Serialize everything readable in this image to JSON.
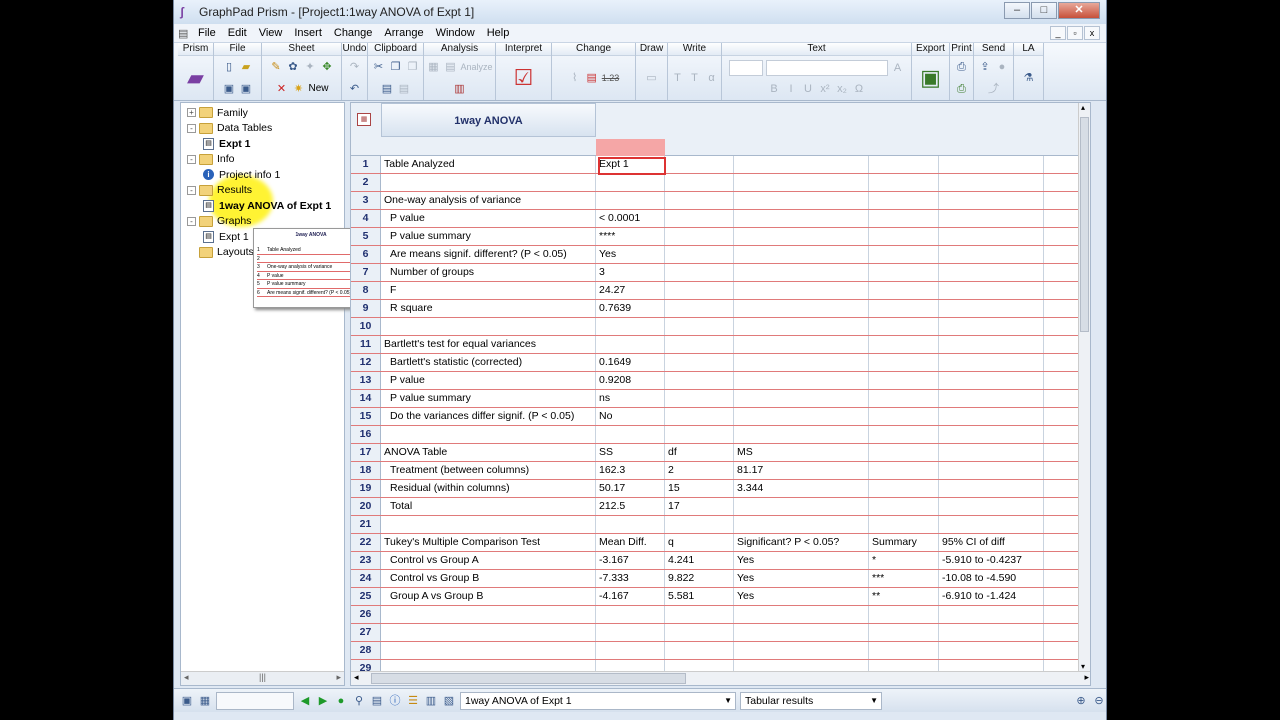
{
  "window": {
    "title": "GraphPad Prism - [Project1:1way ANOVA of Expt 1]"
  },
  "menu": [
    "File",
    "Edit",
    "View",
    "Insert",
    "Change",
    "Arrange",
    "Window",
    "Help"
  ],
  "ribbon": {
    "groups": [
      "Prism",
      "File",
      "Sheet",
      "Undo",
      "Clipboard",
      "Analysis",
      "Interpret",
      "Change",
      "Draw",
      "Write",
      "Text",
      "Export",
      "Print",
      "Send",
      "LA"
    ],
    "new_label": "New",
    "analyze_label": "Analyze",
    "change_value": "1.23"
  },
  "navigator": {
    "items": [
      {
        "label": "Family",
        "kind": "folder",
        "level": 0,
        "exp": "+"
      },
      {
        "label": "Data Tables",
        "kind": "folder",
        "level": 0,
        "exp": "-"
      },
      {
        "label": "Expt 1",
        "kind": "sheet",
        "level": 1,
        "bold": true
      },
      {
        "label": "Info",
        "kind": "folder",
        "level": 0,
        "exp": "-"
      },
      {
        "label": "Project info 1",
        "kind": "info",
        "level": 1
      },
      {
        "label": "Results",
        "kind": "folder",
        "level": 0,
        "exp": "-"
      },
      {
        "label": "1way ANOVA of Expt 1",
        "kind": "sheet",
        "level": 1,
        "bold": true
      },
      {
        "label": "Graphs",
        "kind": "folder",
        "level": 0,
        "exp": "-"
      },
      {
        "label": "Expt 1",
        "kind": "sheet",
        "level": 1
      },
      {
        "label": "Layouts",
        "kind": "folder",
        "level": 0,
        "exp": ""
      }
    ],
    "thumb": {
      "title": "1way ANOVA",
      "rows": [
        "Table Analyzed",
        "",
        "One-way analysis of variance",
        "P value",
        "P value summary",
        "Are means signif. different? (P < 0.05)"
      ]
    }
  },
  "sheet": {
    "name": "1way ANOVA",
    "rows": [
      [
        "1",
        "Table Analyzed",
        "Expt 1",
        "",
        "",
        "",
        ""
      ],
      [
        "2",
        "",
        "",
        "",
        "",
        "",
        ""
      ],
      [
        "3",
        "One-way analysis of variance",
        "",
        "",
        "",
        "",
        ""
      ],
      [
        "4",
        "  P value",
        "< 0.0001",
        "",
        "",
        "",
        ""
      ],
      [
        "5",
        "  P value summary",
        "****",
        "",
        "",
        "",
        ""
      ],
      [
        "6",
        "  Are means signif. different? (P < 0.05)",
        "Yes",
        "",
        "",
        "",
        ""
      ],
      [
        "7",
        "  Number of groups",
        "3",
        "",
        "",
        "",
        ""
      ],
      [
        "8",
        "  F",
        "24.27",
        "",
        "",
        "",
        ""
      ],
      [
        "9",
        "  R square",
        "0.7639",
        "",
        "",
        "",
        ""
      ],
      [
        "10",
        "",
        "",
        "",
        "",
        "",
        ""
      ],
      [
        "11",
        "Bartlett's test for equal variances",
        "",
        "",
        "",
        "",
        ""
      ],
      [
        "12",
        "  Bartlett's statistic (corrected)",
        "0.1649",
        "",
        "",
        "",
        ""
      ],
      [
        "13",
        "  P value",
        "0.9208",
        "",
        "",
        "",
        ""
      ],
      [
        "14",
        "  P value summary",
        "ns",
        "",
        "",
        "",
        ""
      ],
      [
        "15",
        "  Do the variances differ signif. (P < 0.05)",
        "No",
        "",
        "",
        "",
        ""
      ],
      [
        "16",
        "",
        "",
        "",
        "",
        "",
        ""
      ],
      [
        "17",
        "ANOVA Table",
        "SS",
        "df",
        "MS",
        "",
        ""
      ],
      [
        "18",
        "  Treatment (between columns)",
        "162.3",
        "2",
        "81.17",
        "",
        ""
      ],
      [
        "19",
        "  Residual (within columns)",
        "50.17",
        "15",
        "3.344",
        "",
        ""
      ],
      [
        "20",
        "  Total",
        "212.5",
        "17",
        "",
        "",
        ""
      ],
      [
        "21",
        "",
        "",
        "",
        "",
        "",
        ""
      ],
      [
        "22",
        "Tukey's Multiple Comparison Test",
        "Mean Diff.",
        "q",
        "Significant? P < 0.05?",
        "Summary",
        "95% CI of diff"
      ],
      [
        "23",
        "  Control vs Group A",
        "-3.167",
        "4.241",
        "Yes",
        "*",
        "-5.910 to -0.4237"
      ],
      [
        "24",
        "  Control vs Group B",
        "-7.333",
        "9.822",
        "Yes",
        "***",
        "-10.08 to -4.590"
      ],
      [
        "25",
        "  Group A vs Group B",
        "-4.167",
        "5.581",
        "Yes",
        "**",
        "-6.910 to -1.424"
      ],
      [
        "26",
        "",
        "",
        "",
        "",
        "",
        ""
      ],
      [
        "27",
        "",
        "",
        "",
        "",
        "",
        ""
      ],
      [
        "28",
        "",
        "",
        "",
        "",
        "",
        ""
      ],
      [
        "29",
        "",
        "",
        "",
        "",
        "",
        ""
      ]
    ]
  },
  "statusbar": {
    "sheet_select": "1way ANOVA of Expt 1",
    "view_select": "Tabular results"
  },
  "colors": {
    "accent": "#203070",
    "row_line": "#e07a7a",
    "selected": "#f5a6a6"
  }
}
